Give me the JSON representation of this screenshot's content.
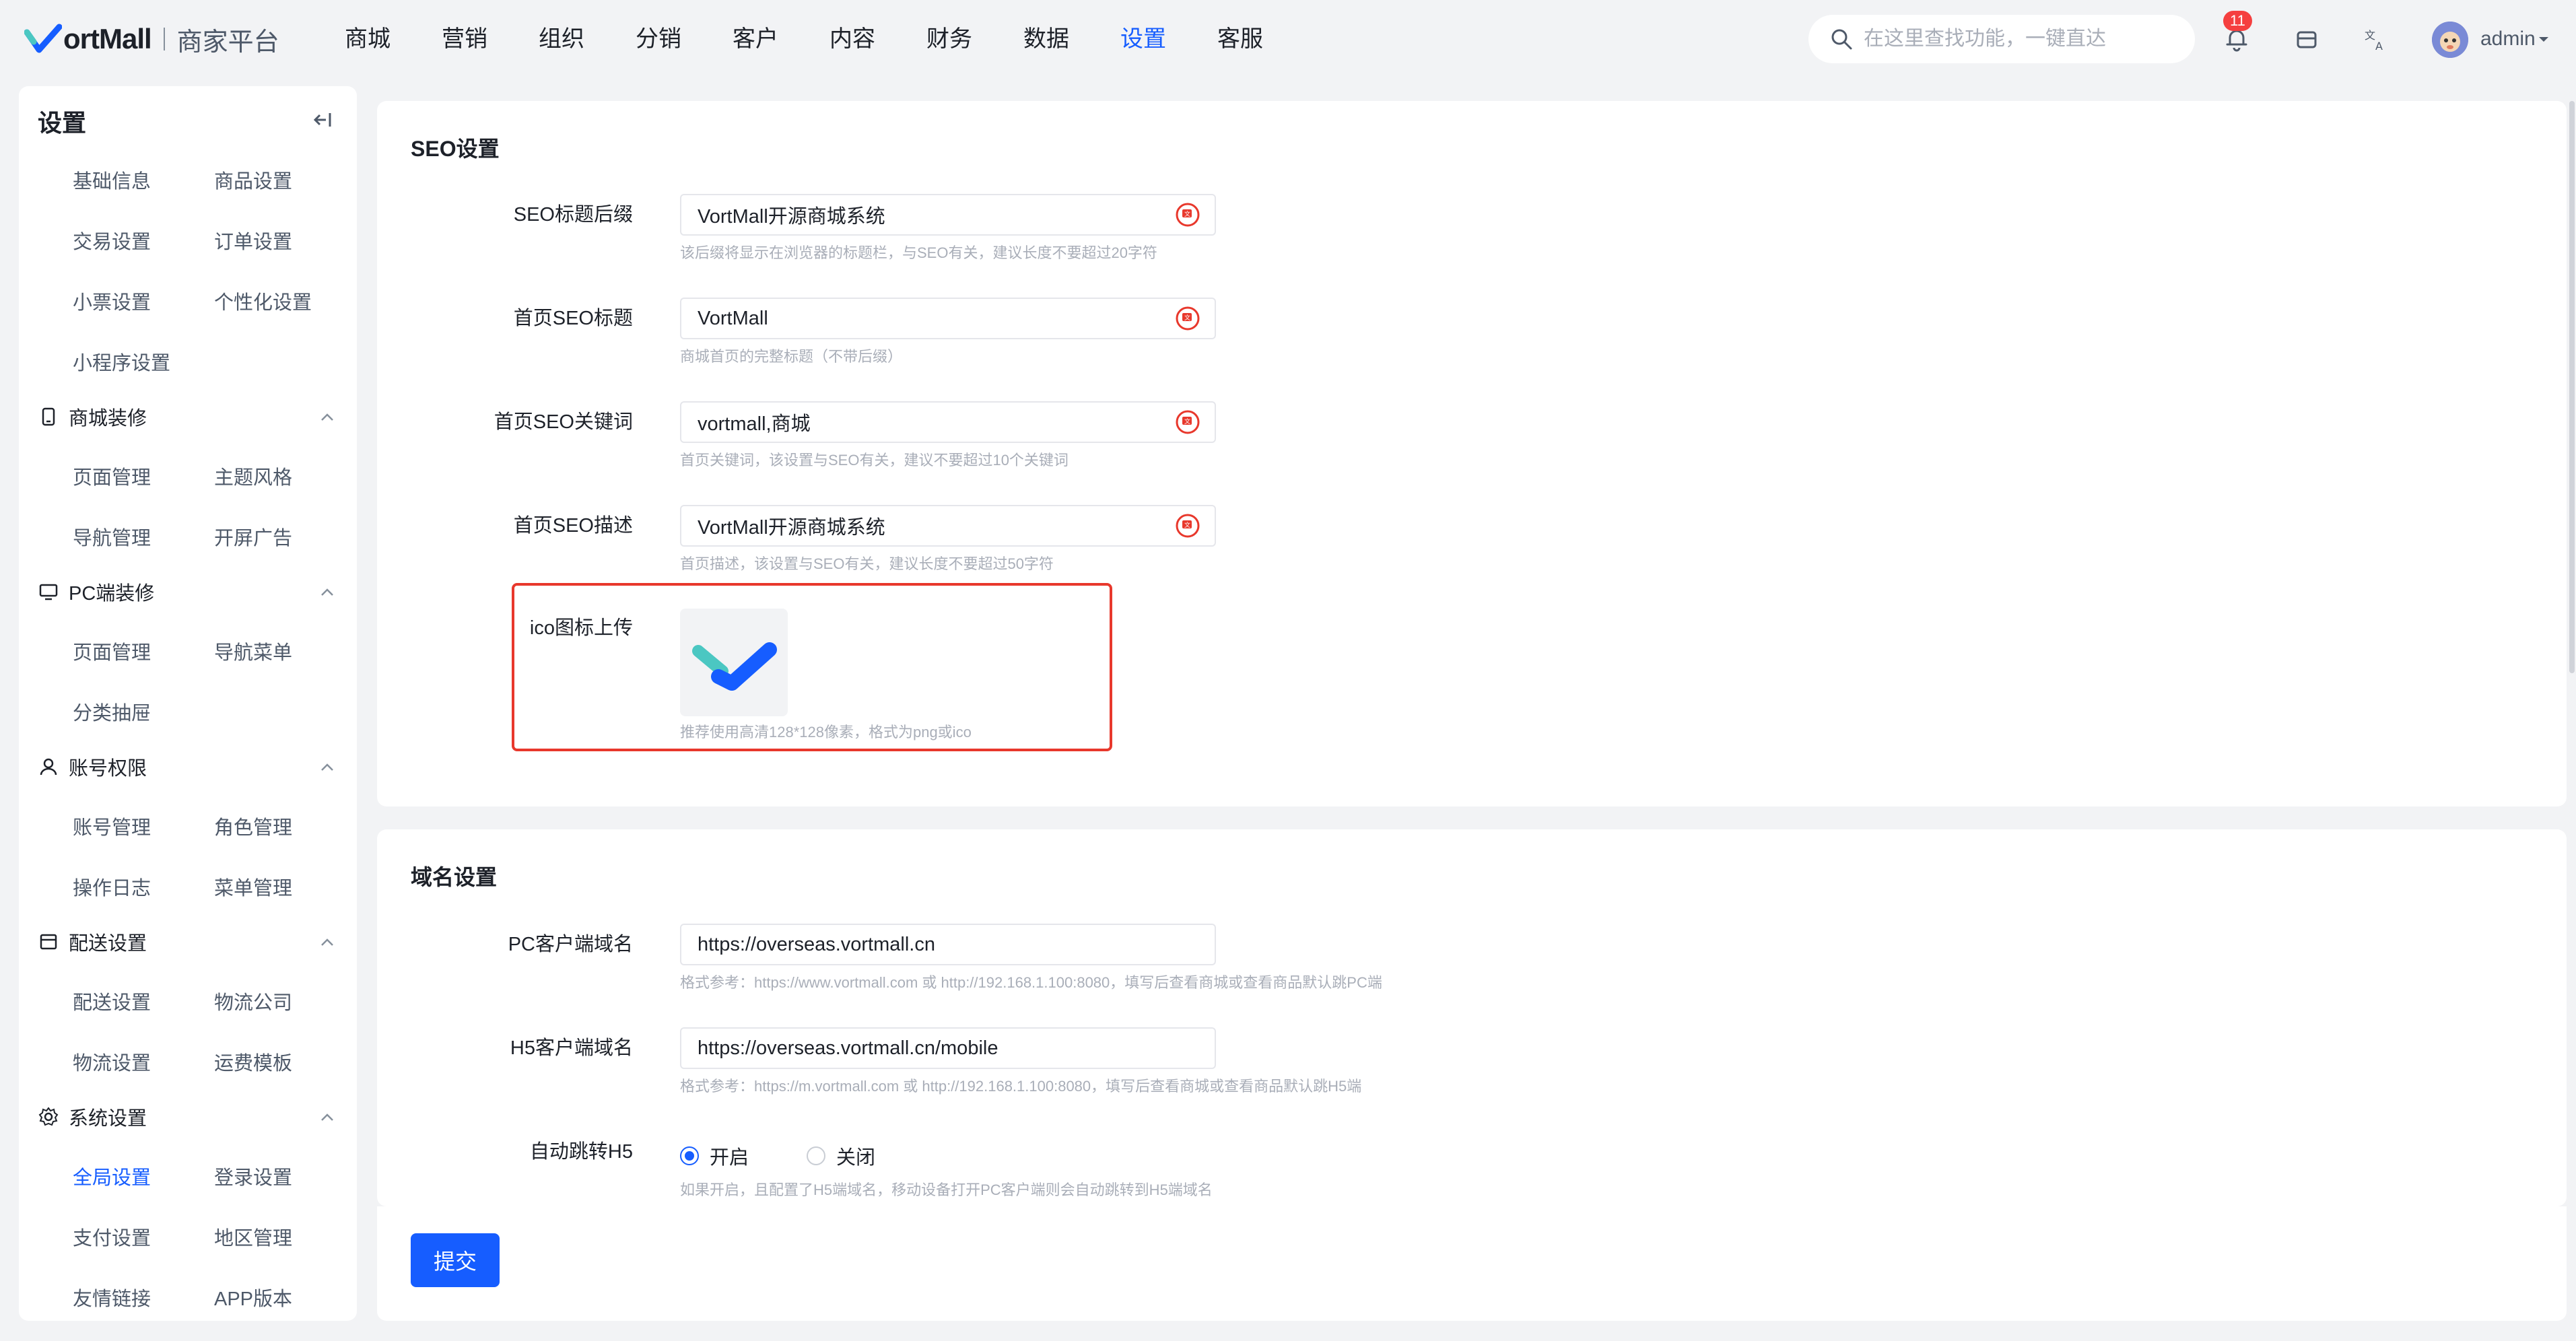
{
  "brand": {
    "name": "ortMall",
    "sub": "商家平台"
  },
  "nav": [
    "商城",
    "营销",
    "组织",
    "分销",
    "客户",
    "内容",
    "财务",
    "数据",
    "设置",
    "客服"
  ],
  "nav_active": "设置",
  "search": {
    "placeholder": "在这里查找功能，一键直达"
  },
  "notifications": {
    "count": "11"
  },
  "user": {
    "name": "admin"
  },
  "sidebar": {
    "title": "设置",
    "top_items": [
      "基础信息",
      "商品设置",
      "交易设置",
      "订单设置",
      "小票设置",
      "个性化设置",
      "小程序设置"
    ],
    "groups": [
      {
        "title": "商城装修",
        "icon": "phone-icon",
        "items": [
          "页面管理",
          "主题风格",
          "导航管理",
          "开屏广告"
        ]
      },
      {
        "title": "PC端装修",
        "icon": "monitor-icon",
        "items": [
          "页面管理",
          "导航菜单",
          "分类抽屉"
        ]
      },
      {
        "title": "账号权限",
        "icon": "user-icon",
        "items": [
          "账号管理",
          "角色管理",
          "操作日志",
          "菜单管理"
        ]
      },
      {
        "title": "配送设置",
        "icon": "box-icon",
        "items": [
          "配送设置",
          "物流公司",
          "物流设置",
          "运费模板"
        ]
      },
      {
        "title": "系统设置",
        "icon": "gear-icon",
        "items": [
          "全局设置",
          "登录设置",
          "支付设置",
          "地区管理",
          "友情链接",
          "APP版本"
        ]
      }
    ],
    "active_item": "全局设置"
  },
  "seo": {
    "title": "SEO设置",
    "fields": [
      {
        "label": "SEO标题后缀",
        "value": "VortMall开源商城系统",
        "hint": "该后缀将显示在浏览器的标题栏，与SEO有关，建议长度不要超过20字符"
      },
      {
        "label": "首页SEO标题",
        "value": "VortMall",
        "hint": "商城首页的完整标题（不带后缀）"
      },
      {
        "label": "首页SEO关键词",
        "value": "vortmall,商城",
        "hint": "首页关键词，该设置与SEO有关，建议不要超过10个关键词"
      },
      {
        "label": "首页SEO描述",
        "value": "VortMall开源商城系统",
        "hint": "首页描述，该设置与SEO有关，建议长度不要超过50字符"
      }
    ],
    "ico": {
      "label": "ico图标上传",
      "hint": "推荐使用高清128*128像素，格式为png或ico"
    }
  },
  "domain": {
    "title": "域名设置",
    "fields": [
      {
        "label": "PC客户端域名",
        "value": "https://overseas.vortmall.cn",
        "hint": "格式参考：https://www.vortmall.com 或 http://192.168.1.100:8080，填写后查看商城或查看商品默认跳PC端"
      },
      {
        "label": "H5客户端域名",
        "value": "https://overseas.vortmall.cn/mobile",
        "hint": "格式参考：https://m.vortmall.com 或 http://192.168.1.100:8080，填写后查看商城或查看商品默认跳H5端"
      }
    ],
    "redirect": {
      "label": "自动跳转H5",
      "options": [
        "开启",
        "关闭"
      ],
      "selected": "开启",
      "hint": "如果开启，且配置了H5端域名，移动设备打开PC客户端则会自动跳转到H5端域名"
    }
  },
  "submit_label": "提交",
  "colors": {
    "primary": "#165dff",
    "highlight": "#e8382c",
    "badge": "#f53f3f"
  }
}
